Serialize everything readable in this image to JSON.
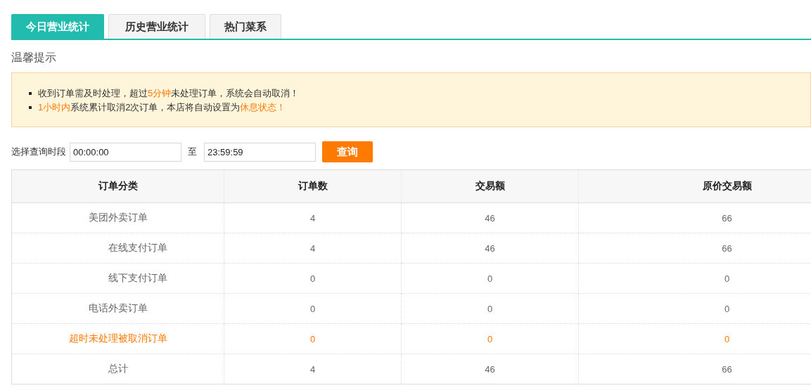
{
  "tabs": [
    {
      "label": "今日营业统计",
      "selected": true
    },
    {
      "label": "历史营业统计",
      "selected": false
    },
    {
      "label": "热门菜系",
      "selected": false
    }
  ],
  "notice": {
    "title": "温馨提示",
    "lines": [
      [
        {
          "text": "收到订单需及时处理，超过",
          "highlight": false
        },
        {
          "text": "5分钟",
          "highlight": true
        },
        {
          "text": "未处理订单，系统会自动取消！",
          "highlight": false
        }
      ],
      [
        {
          "text": "1小时内",
          "highlight": true
        },
        {
          "text": "系统累计取消2次订单，本店将自动设置为",
          "highlight": false
        },
        {
          "text": "休息状态！",
          "highlight": true
        }
      ]
    ]
  },
  "query": {
    "label": "选择查询时段",
    "start": "00:00:00",
    "separator": "至",
    "end": "23:59:59",
    "button": "查询"
  },
  "table": {
    "columns": [
      "订单分类",
      "订单数",
      "交易额",
      "原价交易额"
    ],
    "rows": [
      {
        "kind": "main",
        "cells": [
          "美团外卖订单",
          "4",
          "46",
          "66"
        ]
      },
      {
        "kind": "sub",
        "cells": [
          "在线支付订单",
          "4",
          "46",
          "66"
        ]
      },
      {
        "kind": "sub",
        "cells": [
          "线下支付订单",
          "0",
          "0",
          "0"
        ]
      },
      {
        "kind": "main",
        "cells": [
          "电话外卖订单",
          "0",
          "0",
          "0"
        ]
      },
      {
        "kind": "warning",
        "cells": [
          "超时未处理被取消订单",
          "0",
          "0",
          "0"
        ]
      },
      {
        "kind": "main",
        "cells": [
          "总计",
          "4",
          "46",
          "66"
        ]
      }
    ]
  }
}
